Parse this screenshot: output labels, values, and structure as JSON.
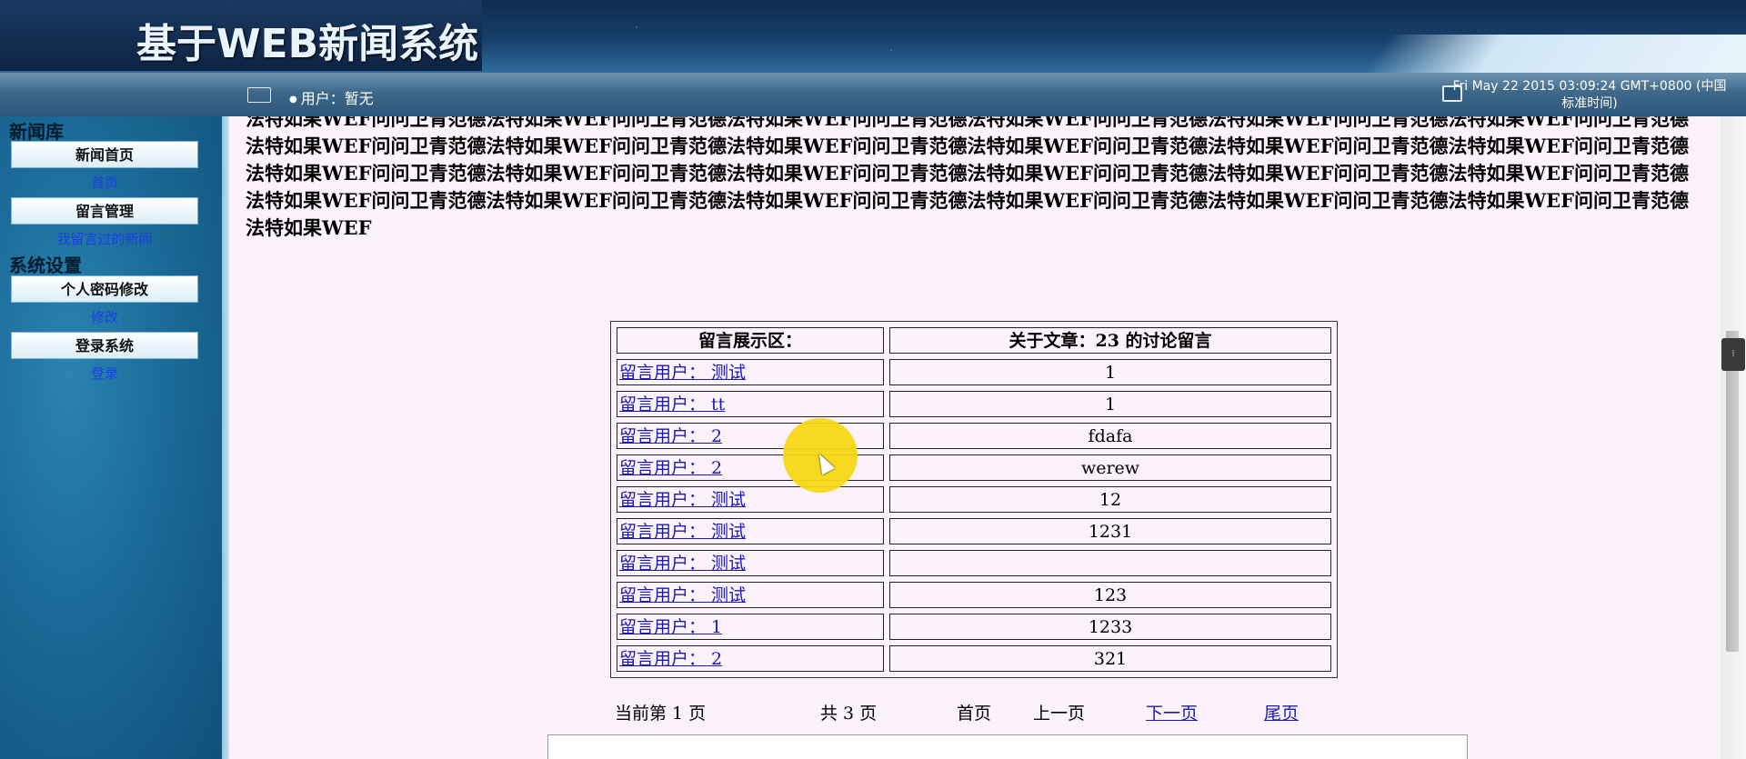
{
  "header": {
    "title": "基于WEB新闻系统"
  },
  "toolbar": {
    "user_label": "用户：暂无",
    "clock_line1": "Fri May 22 2015 03:09:24 GMT+0800 (中国",
    "clock_line2": "标准时间)"
  },
  "sidebar": {
    "sections": [
      {
        "title": "新闻库",
        "items": [
          {
            "label": "新闻首页",
            "link": "首页"
          },
          {
            "label": "留言管理",
            "link": "我留言过的新闻"
          }
        ]
      },
      {
        "title": "系统设置",
        "items": [
          {
            "label": "个人密码修改",
            "link": "修改"
          },
          {
            "label": "登录系统",
            "link": "登录"
          }
        ]
      }
    ]
  },
  "article": {
    "text": "法特如果WEF问问卫青范德法特如果WEF问问卫青范德法特如果WEF问问卫青范德法特如果WEF问问卫青范德法特如果WEF问问卫青范德法特如果WEF问问卫青范德法特如果WEF问问卫青范德法特如果WEF问问卫青范德法特如果WEF问问卫青范德法特如果WEF问问卫青范德法特如果WEF问问卫青范德法特如果WEF问问卫青范德法特如果WEF问问卫青范德法特如果WEF问问卫青范德法特如果WEF问问卫青范德法特如果WEF问问卫青范德法特如果WEF问问卫青范德法特如果WEF问问卫青范德法特如果WEF问问卫青范德法特如果WEF问问卫青范德法特如果WEF问问卫青范德法特如果WEF问问卫青范德法特如果WEF问问卫青范德法特如果WEF问问卫青范德法特如果WEF"
  },
  "comments": {
    "header_left": "留言展示区：",
    "header_right": "关于文章：23 的讨论留言",
    "rows": [
      {
        "user": "留言用户： 测试",
        "msg": "1"
      },
      {
        "user": "留言用户： tt",
        "msg": "1"
      },
      {
        "user": "留言用户： 2",
        "msg": "fdafa"
      },
      {
        "user": "留言用户： 2",
        "msg": "werew"
      },
      {
        "user": "留言用户： 测试",
        "msg": "12"
      },
      {
        "user": "留言用户： 测试",
        "msg": "1231"
      },
      {
        "user": "留言用户： 测试",
        "msg": ""
      },
      {
        "user": "留言用户： 测试",
        "msg": "123"
      },
      {
        "user": "留言用户： 1",
        "msg": "1233"
      },
      {
        "user": "留言用户： 2",
        "msg": "321"
      }
    ]
  },
  "pager": {
    "current": "当前第 1 页",
    "total": "共 3 页",
    "first": "首页",
    "prev": "上一页",
    "next": "下一页",
    "last": "尾页"
  },
  "colors": {
    "link": "#1a1ab8",
    "sidebar_link": "#1a3ee8",
    "main_bg": "#fcf2fb",
    "cursor_highlight": "#f5d714"
  }
}
